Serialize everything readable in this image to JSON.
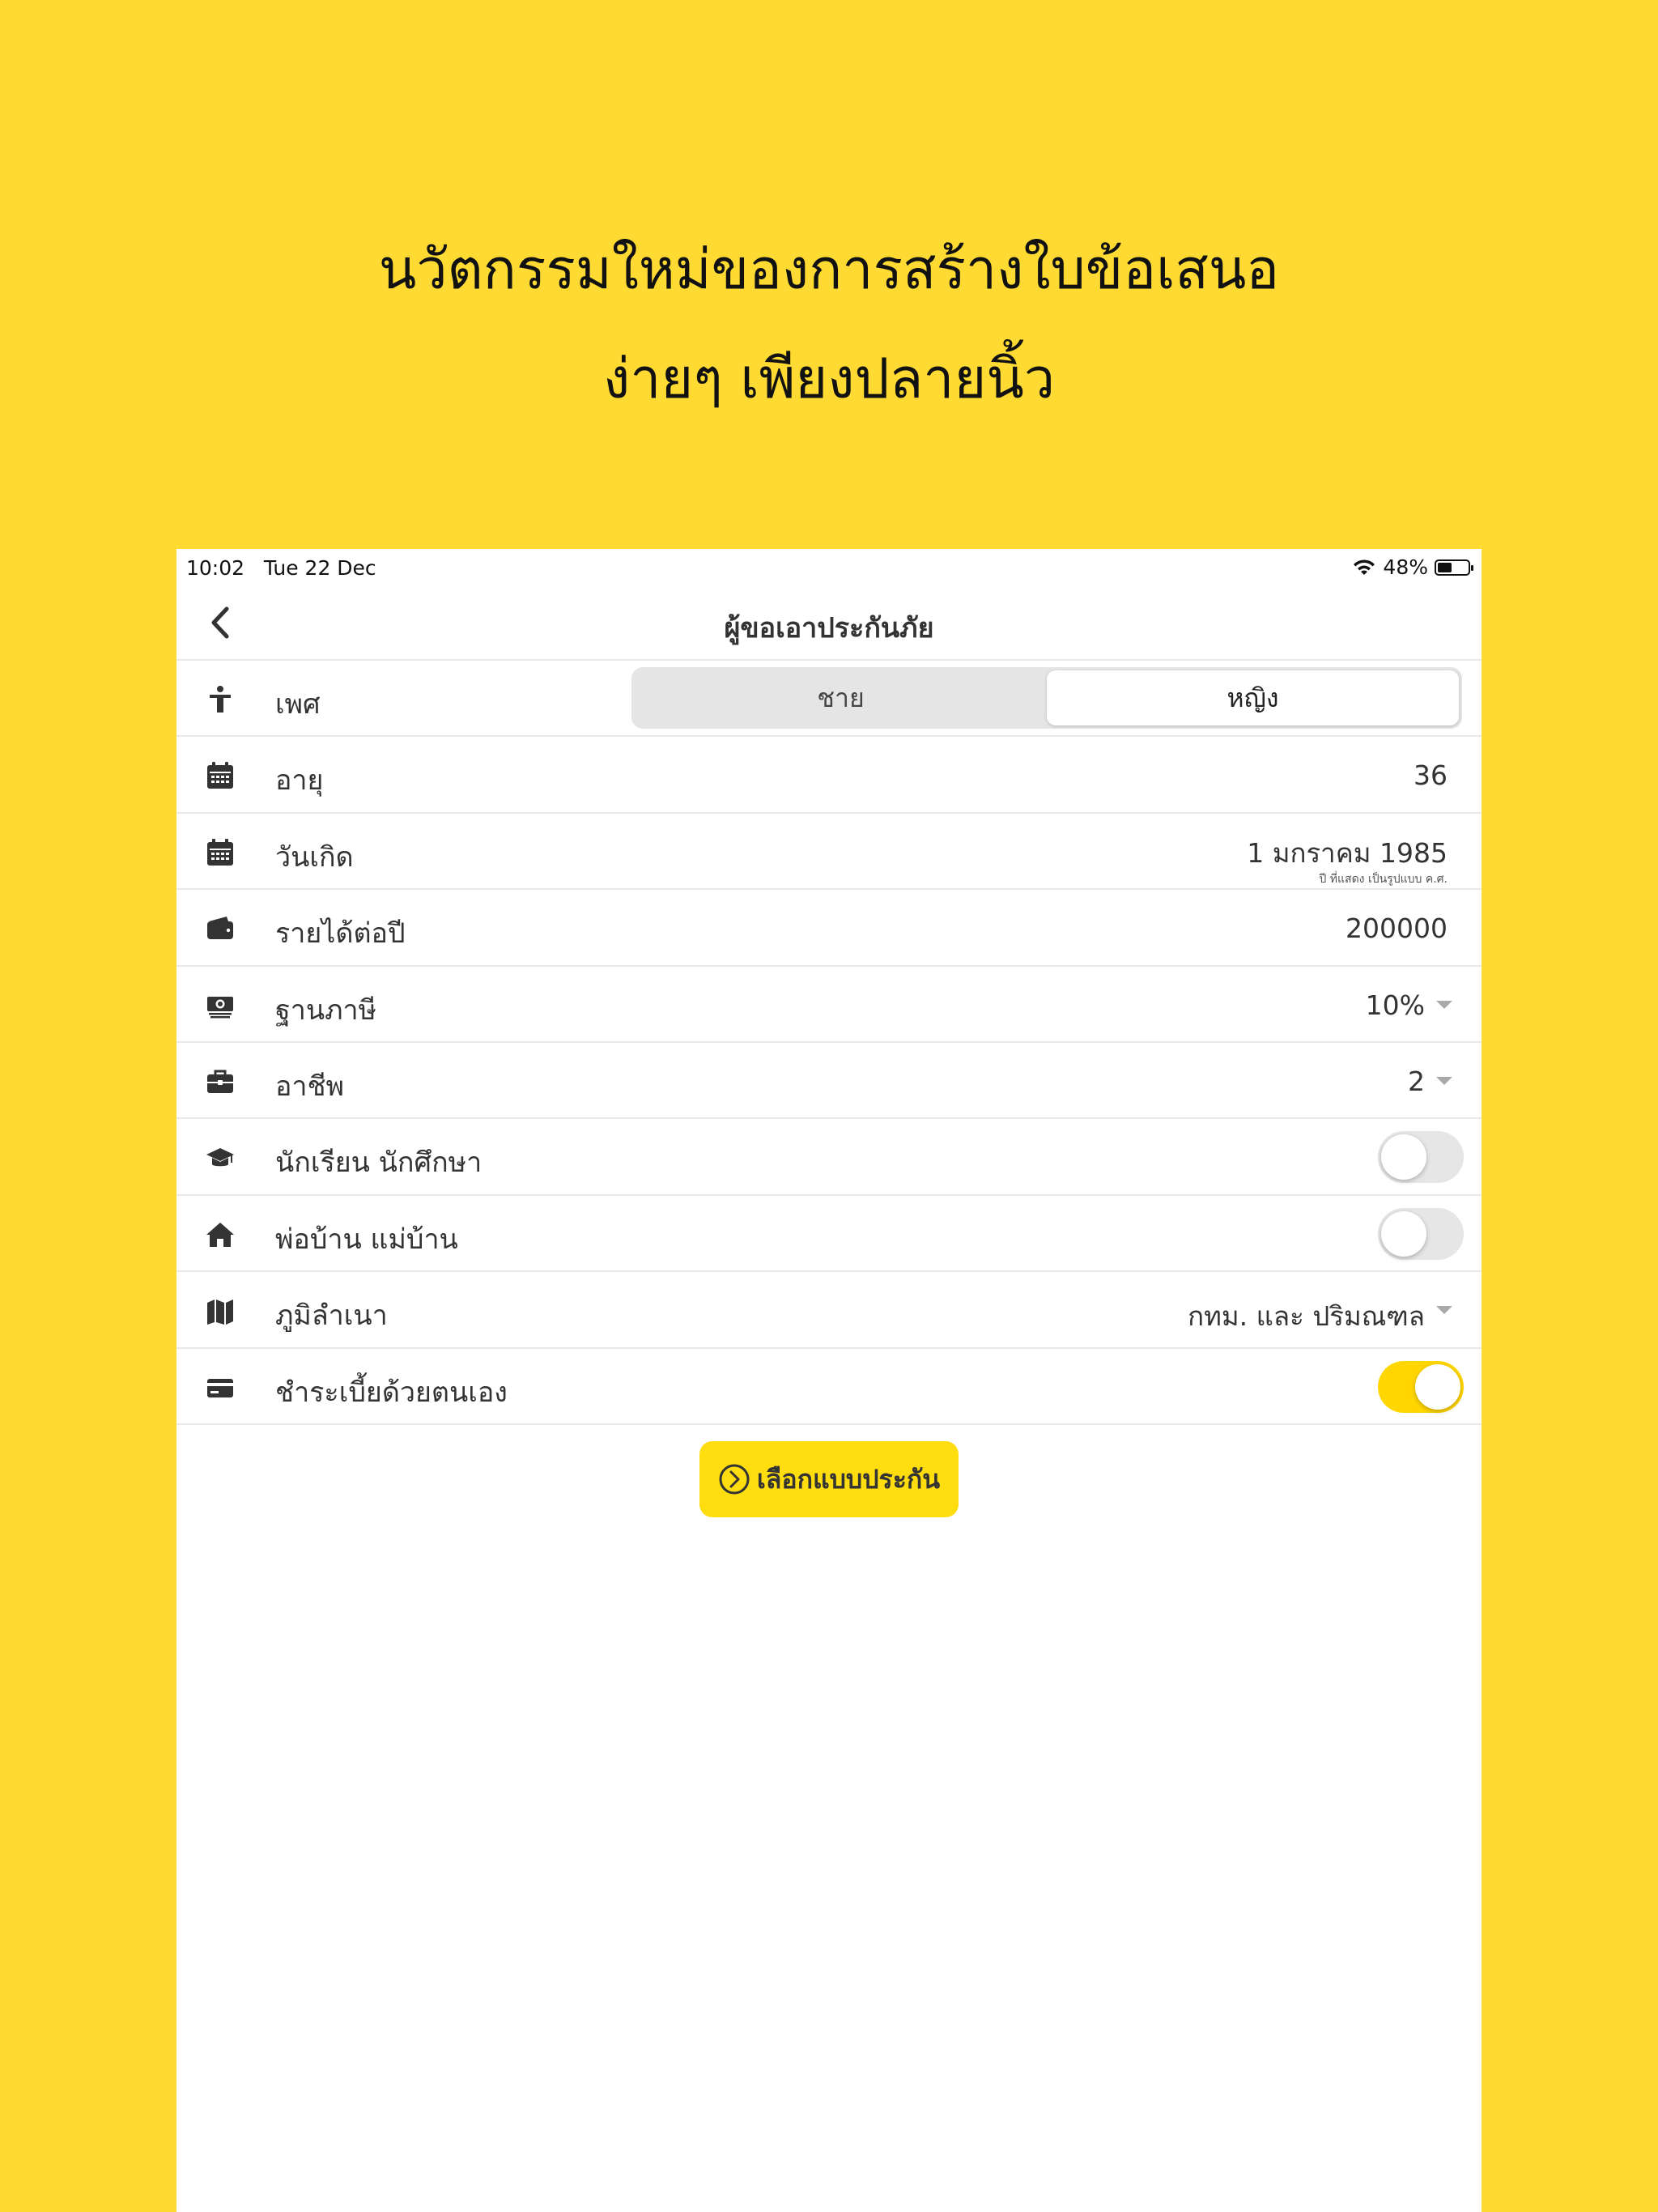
{
  "promo": {
    "line1": "นวัตกรรมใหม่ของการสร้างใบข้อเสนอ",
    "line2": "ง่ายๆ เพียงปลายนิ้ว"
  },
  "status_bar": {
    "time": "10:02",
    "date": "Tue 22 Dec",
    "battery": "48%",
    "battery_level": 0.48
  },
  "nav": {
    "title": "ผู้ขอเอาประกันภัย",
    "back_icon": "chevron-left-icon"
  },
  "form": {
    "gender": {
      "label": "เพศ",
      "icon": "person-icon",
      "options": [
        "ชาย",
        "หญิง"
      ],
      "selected": "หญิง"
    },
    "age": {
      "label": "อายุ",
      "icon": "calendar-icon",
      "value": "36"
    },
    "birthday": {
      "label": "วันเกิด",
      "icon": "calendar-icon",
      "value": "1 มกราคม 1985",
      "note": "ปี ที่แสดง เป็นรูปแบบ ค.ศ."
    },
    "income": {
      "label": "รายได้ต่อปี",
      "icon": "wallet-icon",
      "value": "200000"
    },
    "tax": {
      "label": "ฐานภาษี",
      "icon": "money-icon",
      "value": "10%"
    },
    "occupation": {
      "label": "อาชีพ",
      "icon": "briefcase-icon",
      "value": "2"
    },
    "student": {
      "label": "นักเรียน นักศึกษา",
      "icon": "graduation-cap-icon",
      "on": false
    },
    "homemaker": {
      "label": "พ่อบ้าน แม่บ้าน",
      "icon": "home-icon",
      "on": false
    },
    "domicile": {
      "label": "ภูมิลำเนา",
      "icon": "map-icon",
      "value": "กทม. และ ปริมณฑล"
    },
    "self_pay": {
      "label": "ชำระเบี้ยด้วยตนเอง",
      "icon": "credit-card-icon",
      "on": true
    }
  },
  "cta": {
    "label": "เลือกแบบประกัน",
    "icon": "chevron-circle-right-icon"
  },
  "colors": {
    "background": "#FEDA32",
    "accent": "#FFDD0F",
    "toggle_on": "#FFD600"
  }
}
